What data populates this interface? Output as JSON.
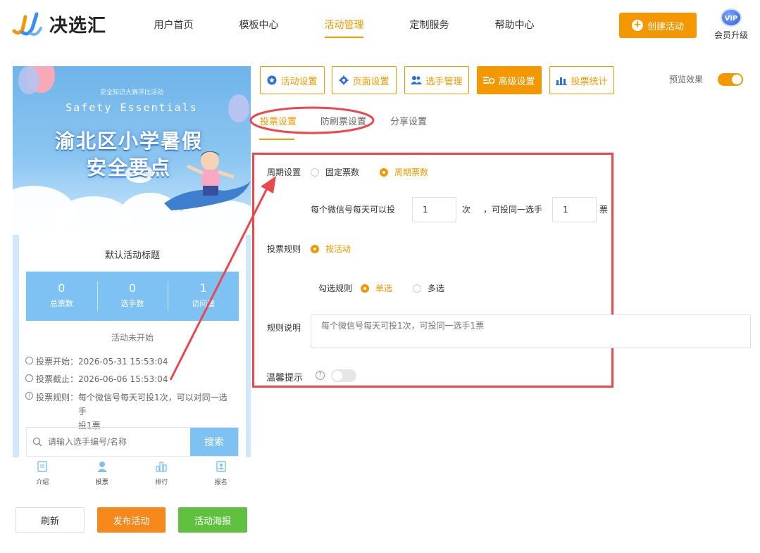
{
  "brand": {
    "name": "决选汇"
  },
  "nav": {
    "items": [
      {
        "label": "用户首页"
      },
      {
        "label": "模板中心"
      },
      {
        "label": "活动管理"
      },
      {
        "label": "定制服务"
      },
      {
        "label": "帮助中心"
      }
    ],
    "active": "活动管理"
  },
  "header": {
    "create_label": "创建活动",
    "vip_badge": "VIP",
    "vip_label": "会员升级"
  },
  "preview": {
    "banner_small": "安全知识大赛评比活动",
    "banner_en": "Safety  Essentials",
    "banner_title_line1": "渝北区小学暑假",
    "banner_title_line2": "安全要点",
    "activity_title": "默认活动标题",
    "stats": [
      {
        "value": "0",
        "label": "总票数"
      },
      {
        "value": "0",
        "label": "选手数"
      },
      {
        "value": "1",
        "label": "访问量"
      }
    ],
    "status": "活动未开始",
    "vote_start": "投票开始：2026-05-31 15:53:04",
    "vote_end": "投票截止：2026-06-06 15:53:04",
    "vote_rule_prefix": "投票规则：",
    "vote_rule_line1": "每个微信号每天可投1次，可以对同一选手",
    "vote_rule_line2": "投1票",
    "search_placeholder": "请输入选手编号/名称",
    "search_button": "搜索",
    "tabs": [
      {
        "label": "介绍"
      },
      {
        "label": "投票"
      },
      {
        "label": "排行"
      },
      {
        "label": "报名"
      }
    ]
  },
  "bottom_buttons": {
    "refresh": "刷新",
    "publish": "发布活动",
    "poster": "活动海报"
  },
  "toolbar": {
    "items": [
      {
        "label": "活动设置"
      },
      {
        "label": "页面设置"
      },
      {
        "label": "选手管理"
      },
      {
        "label": "高级设置"
      },
      {
        "label": "投票统计"
      }
    ],
    "preview_label": "预览效果"
  },
  "subtabs": [
    {
      "label": "投票设置"
    },
    {
      "label": "防刷票设置"
    },
    {
      "label": "分享设置"
    }
  ],
  "form": {
    "period_label": "周期设置",
    "period_fixed": "固定票数",
    "period_cycle": "周期票数",
    "per_day_text": "每个微信号每天可以投",
    "times_value": "1",
    "times_unit": "次",
    "same_player_text": "，可投同一选手",
    "votes_value": "1",
    "votes_unit": "票",
    "rule_label": "投票规则",
    "rule_by_activity": "按活动",
    "select_rule_label": "勾选规则",
    "single_choice": "单选",
    "multi_choice": "多选",
    "desc_label": "规则说明",
    "desc_placeholder": "每个微信号每天可投1次，可投同一选手1票",
    "tip_label": "温馨提示"
  },
  "colors": {
    "accent": "#f39800",
    "annotation": "#e8484e",
    "preview_blue": "#7ec1f3",
    "publish": "#f7881c",
    "poster": "#5fc13f"
  }
}
